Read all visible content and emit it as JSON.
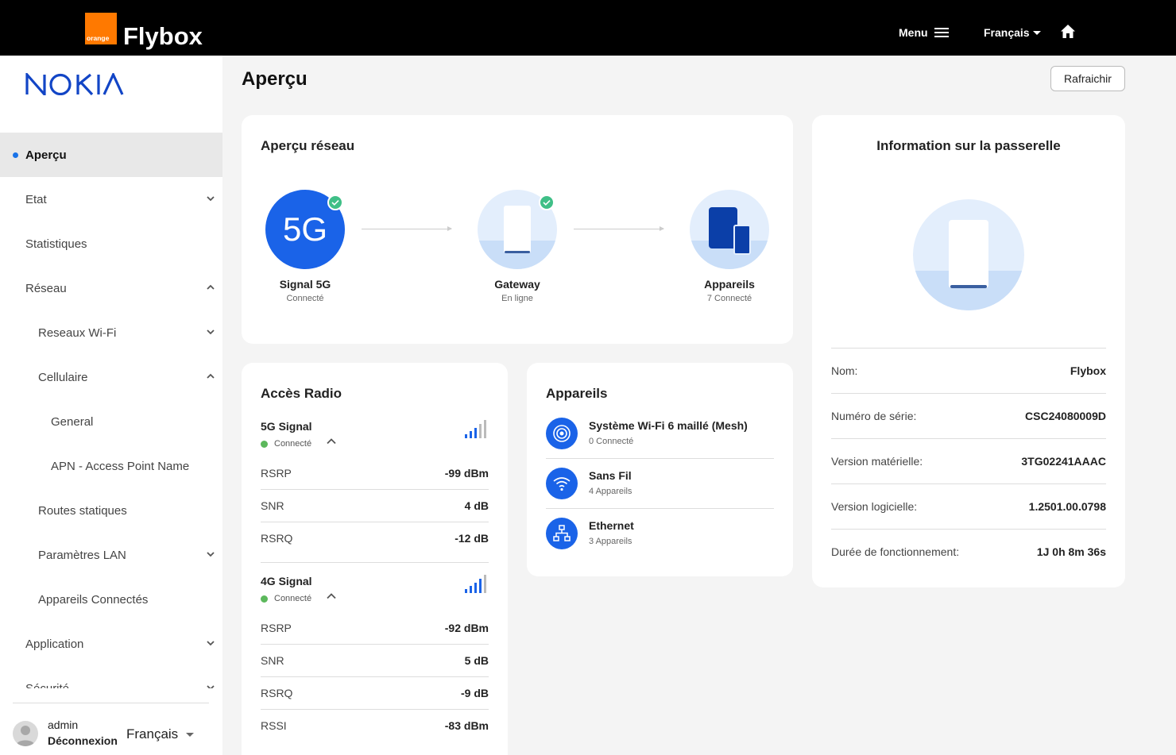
{
  "topbar": {
    "orange_text": "orange",
    "brand": "Flybox",
    "menu_label": "Menu",
    "language": "Français"
  },
  "sidebar": {
    "logo": "NOKIA",
    "items": [
      {
        "label": "Aperçu"
      },
      {
        "label": "Etat"
      },
      {
        "label": "Statistiques"
      },
      {
        "label": "Réseau"
      },
      {
        "label": "Reseaux Wi-Fi"
      },
      {
        "label": "Cellulaire"
      },
      {
        "label": "General"
      },
      {
        "label": "APN - Access Point Name"
      },
      {
        "label": "Routes statiques"
      },
      {
        "label": "Paramètres LAN"
      },
      {
        "label": "Appareils Connectés"
      },
      {
        "label": "Application"
      },
      {
        "label": "Sécurité"
      }
    ],
    "user": "admin",
    "logout": "Déconnexion",
    "language": "Français"
  },
  "page": {
    "title": "Aperçu",
    "refresh": "Rafraichir"
  },
  "network": {
    "title": "Aperçu réseau",
    "nodes": [
      {
        "badge": "5G",
        "label": "Signal 5G",
        "status": "Connecté"
      },
      {
        "label": "Gateway",
        "status": "En ligne"
      },
      {
        "label": "Appareils",
        "status": "7 Connecté"
      }
    ]
  },
  "radio": {
    "title": "Accès Radio",
    "signals": [
      {
        "name": "5G Signal",
        "status": "Connecté",
        "rows": [
          {
            "k": "RSRP",
            "v": "-99 dBm"
          },
          {
            "k": "SNR",
            "v": "4 dB"
          },
          {
            "k": "RSRQ",
            "v": "-12 dB"
          }
        ]
      },
      {
        "name": "4G Signal",
        "status": "Connecté",
        "rows": [
          {
            "k": "RSRP",
            "v": "-92 dBm"
          },
          {
            "k": "SNR",
            "v": "5 dB"
          },
          {
            "k": "RSRQ",
            "v": "-9 dB"
          },
          {
            "k": "RSSI",
            "v": "-83 dBm"
          }
        ]
      }
    ]
  },
  "devices": {
    "title": "Appareils",
    "items": [
      {
        "name": "Système Wi-Fi 6 maillé (Mesh)",
        "sub": "0 Connecté",
        "icon": "mesh-icon"
      },
      {
        "name": "Sans Fil",
        "sub": "4 Appareils",
        "icon": "wifi-icon"
      },
      {
        "name": "Ethernet",
        "sub": "3 Appareils",
        "icon": "ethernet-icon"
      }
    ]
  },
  "gateway": {
    "title": "Information sur la passerelle",
    "rows": [
      {
        "k": "Nom:",
        "v": "Flybox"
      },
      {
        "k": "Numéro de série:",
        "v": "CSC24080009D"
      },
      {
        "k": "Version matérielle:",
        "v": "3TG02241AAAC"
      },
      {
        "k": "Version logicielle:",
        "v": "1.2501.00.0798"
      },
      {
        "k": "Durée de fonctionnement:",
        "v": "1J 0h 8m 36s"
      }
    ]
  },
  "colors": {
    "accent": "#1a63e8",
    "orange": "#ff7900",
    "success": "#3fbf87",
    "topbar": "#000000"
  }
}
